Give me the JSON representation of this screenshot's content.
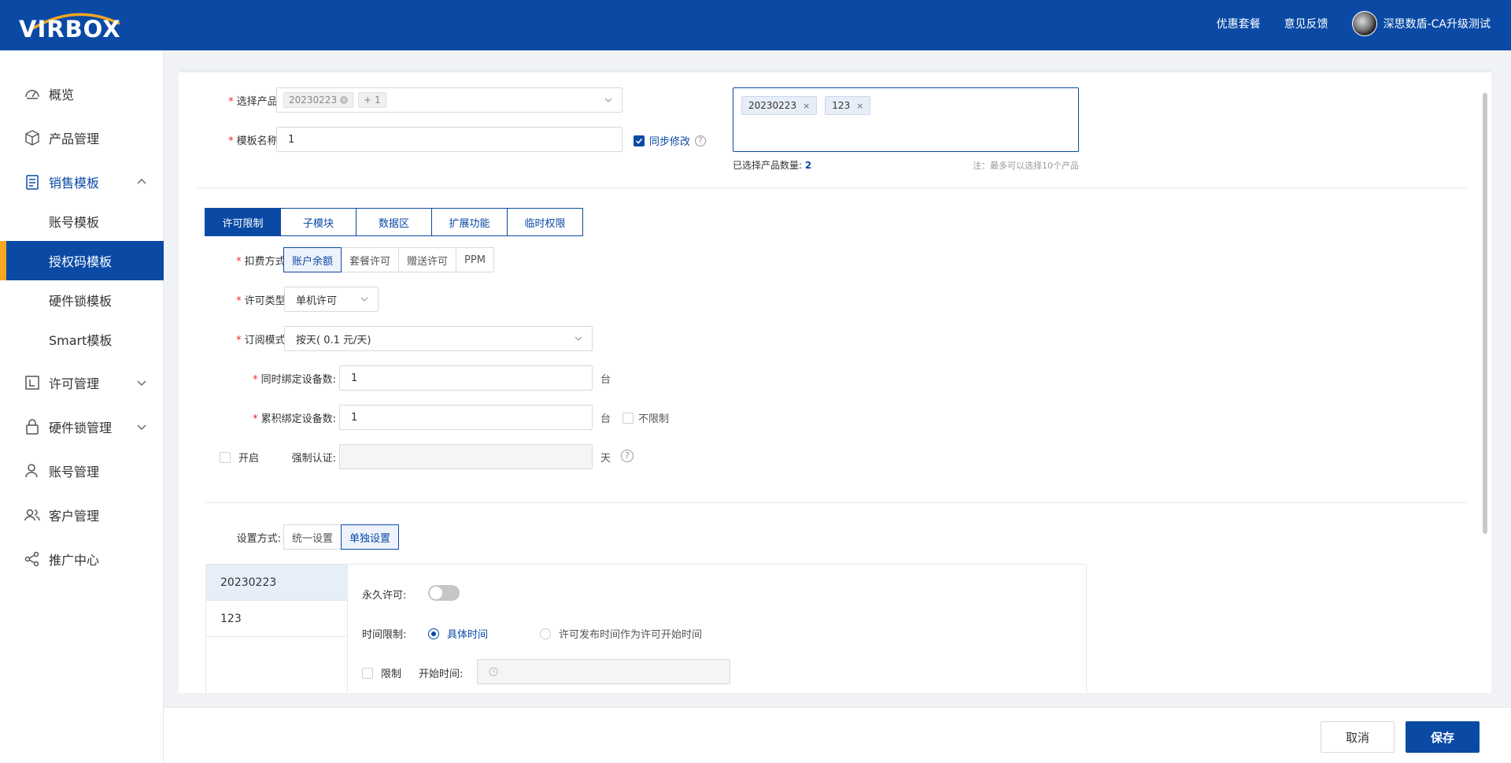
{
  "header": {
    "logo_text": "VIRBOX",
    "links": [
      "优惠套餐",
      "意见反馈"
    ],
    "user_name": "深思数盾-CA升级测试"
  },
  "sidebar": {
    "items": [
      {
        "label": "概览",
        "icon": "dashboard-icon"
      },
      {
        "label": "产品管理",
        "icon": "box-icon"
      },
      {
        "label": "销售模板",
        "icon": "template-icon",
        "expanded": true
      },
      {
        "label": "许可管理",
        "icon": "license-icon"
      },
      {
        "label": "硬件锁管理",
        "icon": "lock-icon"
      },
      {
        "label": "账号管理",
        "icon": "user-icon"
      },
      {
        "label": "客户管理",
        "icon": "customers-icon"
      },
      {
        "label": "推广中心",
        "icon": "share-icon"
      }
    ],
    "sub_items": [
      "账号模板",
      "授权码模板",
      "硬件锁模板",
      "Smart模板"
    ],
    "active_sub": "授权码模板"
  },
  "form": {
    "product_label": "选择产品:",
    "product_tag": "20230223",
    "product_more": "+ 1",
    "template_name_label": "模板名称:",
    "template_name_value": "1",
    "sync_label": "同步修改",
    "selected_tags": [
      "20230223",
      "123"
    ],
    "selected_count_label": "已选择产品数量:",
    "selected_count": "2",
    "note": "注：最多可以选择10个产品"
  },
  "tabs": [
    "许可限制",
    "子模块",
    "数据区",
    "扩展功能",
    "临时权限"
  ],
  "license": {
    "billing_label": "扣费方式:",
    "billing_options": [
      "账户余额",
      "套餐许可",
      "赠送许可",
      "PPM"
    ],
    "type_label": "许可类型:",
    "type_value": "单机许可",
    "subscription_label": "订阅模式:",
    "subscription_value": "按天( 0.1 元/天)",
    "concurrent_label": "同时绑定设备数:",
    "concurrent_value": "1",
    "concurrent_unit": "台",
    "cumulative_label": "累积绑定设备数:",
    "cumulative_value": "1",
    "cumulative_unit": "台",
    "unlimited_label": "不限制",
    "enable_label": "开启",
    "force_label": "强制认证:",
    "force_unit": "天"
  },
  "settings": {
    "mode_label": "设置方式:",
    "mode_options": [
      "统一设置",
      "单独设置"
    ],
    "products": [
      "20230223",
      "123"
    ],
    "permanent_label": "永久许可:",
    "time_limit_label": "时间限制:",
    "time_options": [
      "具体时间",
      "许可发布时间作为许可开始时间"
    ],
    "limit_label": "限制",
    "start_time_label": "开始时间:"
  },
  "footer": {
    "cancel": "取消",
    "save": "保存"
  },
  "colors": {
    "primary": "#0a4aa5",
    "accent": "#f5a623",
    "required": "#f5222d"
  }
}
